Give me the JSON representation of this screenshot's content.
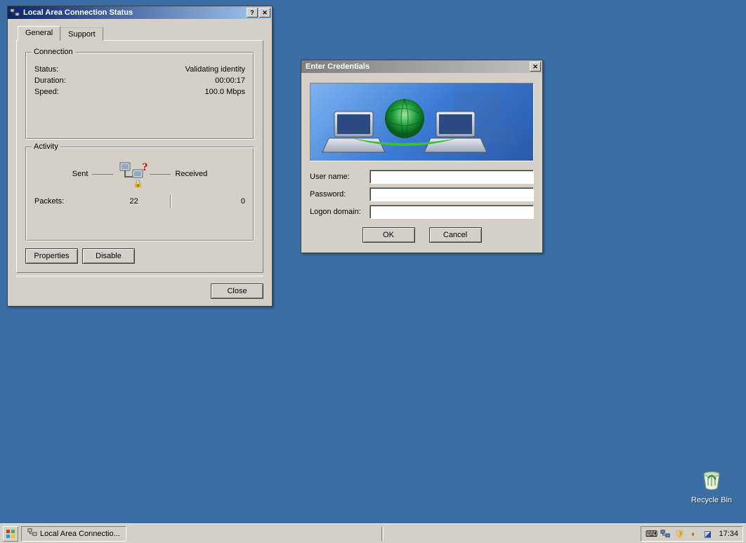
{
  "connection_window": {
    "title": "Local Area Connection Status",
    "tabs": {
      "general": "General",
      "support": "Support"
    },
    "group_connection": {
      "legend": "Connection",
      "status_label": "Status:",
      "status_value": "Validating identity",
      "duration_label": "Duration:",
      "duration_value": "00:00:17",
      "speed_label": "Speed:",
      "speed_value": "100.0 Mbps"
    },
    "group_activity": {
      "legend": "Activity",
      "sent_label": "Sent",
      "received_label": "Received",
      "packets_label": "Packets:",
      "packets_sent": "22",
      "packets_received": "0"
    },
    "buttons": {
      "properties": "Properties",
      "disable": "Disable",
      "close": "Close"
    }
  },
  "credentials_window": {
    "title": "Enter Credentials",
    "username_label": "User name:",
    "password_label": "Password:",
    "domain_label": "Logon domain:",
    "username_value": "",
    "password_value": "",
    "domain_value": "",
    "buttons": {
      "ok": "OK",
      "cancel": "Cancel"
    }
  },
  "desktop": {
    "recycle_bin": "Recycle Bin"
  },
  "taskbar": {
    "task_label": "Local Area Connectio...",
    "clock": "17:34"
  }
}
